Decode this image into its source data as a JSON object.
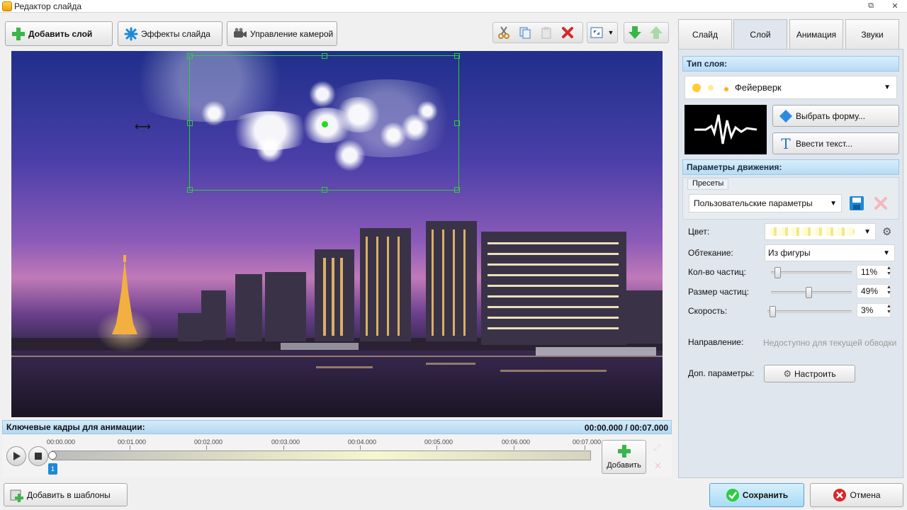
{
  "window": {
    "title": "Редактор слайда",
    "controls": [
      "⧉",
      "✕"
    ]
  },
  "toolbar": {
    "add_layer": "Добавить слой",
    "slide_effects": "Эффекты слайда",
    "camera_control": "Управление камерой"
  },
  "tabs": [
    {
      "label": "Слайд",
      "active": false
    },
    {
      "label": "Слой",
      "active": true
    },
    {
      "label": "Анимация",
      "active": false
    },
    {
      "label": "Звуки",
      "active": false
    }
  ],
  "layer": {
    "type_header": "Тип слоя:",
    "type_value": "Фейерверк",
    "choose_shape": "Выбрать форму...",
    "enter_text": "Ввести текст..."
  },
  "motion": {
    "header": "Параметры движения:",
    "presets_label": "Пресеты",
    "preset_value": "Пользовательские параметры",
    "color_label": "Цвет:",
    "flow_label": "Обтекание:",
    "flow_value": "Из фигуры",
    "count_label": "Кол-во частиц:",
    "count_value": "11%",
    "count_level": 0.05,
    "size_label": "Размер частиц:",
    "size_value": "49%",
    "size_level": 0.47,
    "speed_label": "Скорость:",
    "speed_value": "3%",
    "speed_level": 0.03,
    "direction_label": "Направление:",
    "direction_value": "Недоступно для текущей обводки",
    "extra_label": "Доп. параметры:",
    "configure_button": "Настроить"
  },
  "keyframes": {
    "header": "Ключевые кадры для анимации:",
    "time": "00:00.000 / 00:07.000",
    "ticks": [
      "00:00.000",
      "00:01.000",
      "00:02.000",
      "00:03.000",
      "00:04.000",
      "00:05.000",
      "00:06.000",
      "00:07.000"
    ],
    "marker": "1",
    "add_button": "Добавить"
  },
  "bottom": {
    "add_templates": "Добавить в шаблоны",
    "save": "Сохранить",
    "cancel": "Отмена"
  },
  "colors": {
    "accent_green": "#3bb54a",
    "header_blue": "#b8dbf4",
    "save_green": "#2ecc40",
    "cancel_red": "#d9262a"
  }
}
